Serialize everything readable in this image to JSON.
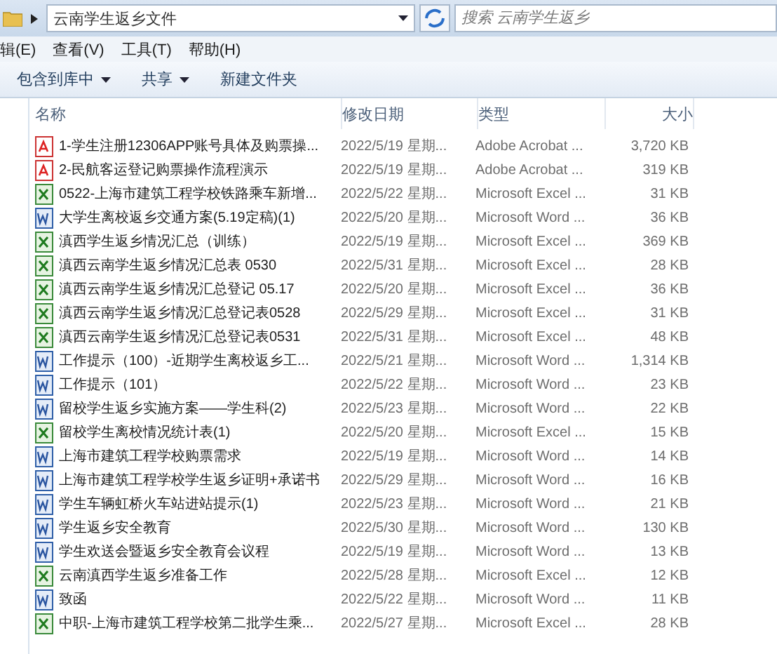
{
  "address_bar": {
    "path": "云南学生返乡文件",
    "search_placeholder": "搜索 云南学生返乡"
  },
  "menu": [
    "辑(E)",
    "查看(V)",
    "工具(T)",
    "帮助(H)"
  ],
  "toolbar": [
    {
      "label": "包含到库中",
      "dropdown": true
    },
    {
      "label": "共享",
      "dropdown": true
    },
    {
      "label": "新建文件夹",
      "dropdown": false
    }
  ],
  "columns": [
    "名称",
    "修改日期",
    "类型",
    "大小"
  ],
  "files": [
    {
      "kind": "pdf",
      "name": "1-学生注册12306APP账号具体及购票操...",
      "date": "2022/5/19 星期...",
      "type": "Adobe Acrobat ...",
      "size": "3,720 KB"
    },
    {
      "kind": "pdf",
      "name": "2-民航客运登记购票操作流程演示",
      "date": "2022/5/19 星期...",
      "type": "Adobe Acrobat ...",
      "size": "319 KB"
    },
    {
      "kind": "excel",
      "name": "0522-上海市建筑工程学校铁路乘车新增...",
      "date": "2022/5/22 星期...",
      "type": "Microsoft Excel ...",
      "size": "31 KB"
    },
    {
      "kind": "word",
      "name": "大学生离校返乡交通方案(5.19定稿)(1)",
      "date": "2022/5/20 星期...",
      "type": "Microsoft Word ...",
      "size": "36 KB"
    },
    {
      "kind": "excel",
      "name": "滇西学生返乡情况汇总（训练）",
      "date": "2022/5/19 星期...",
      "type": "Microsoft Excel ...",
      "size": "369 KB"
    },
    {
      "kind": "excel",
      "name": "滇西云南学生返乡情况汇总表 0530",
      "date": "2022/5/31 星期...",
      "type": "Microsoft Excel ...",
      "size": "28 KB"
    },
    {
      "kind": "excel",
      "name": "滇西云南学生返乡情况汇总登记 05.17",
      "date": "2022/5/20 星期...",
      "type": "Microsoft Excel ...",
      "size": "36 KB"
    },
    {
      "kind": "excel",
      "name": "滇西云南学生返乡情况汇总登记表0528",
      "date": "2022/5/29 星期...",
      "type": "Microsoft Excel ...",
      "size": "31 KB"
    },
    {
      "kind": "excel",
      "name": "滇西云南学生返乡情况汇总登记表0531",
      "date": "2022/5/31 星期...",
      "type": "Microsoft Excel ...",
      "size": "48 KB"
    },
    {
      "kind": "word",
      "name": "工作提示（100）-近期学生离校返乡工...",
      "date": "2022/5/21 星期...",
      "type": "Microsoft Word ...",
      "size": "1,314 KB"
    },
    {
      "kind": "word",
      "name": "工作提示（101）",
      "date": "2022/5/22 星期...",
      "type": "Microsoft Word ...",
      "size": "23 KB"
    },
    {
      "kind": "word",
      "name": "留校学生返乡实施方案——学生科(2)",
      "date": "2022/5/23 星期...",
      "type": "Microsoft Word ...",
      "size": "22 KB"
    },
    {
      "kind": "excel",
      "name": "留校学生离校情况统计表(1)",
      "date": "2022/5/20 星期...",
      "type": "Microsoft Excel ...",
      "size": "15 KB"
    },
    {
      "kind": "word",
      "name": "上海市建筑工程学校购票需求",
      "date": "2022/5/19 星期...",
      "type": "Microsoft Word ...",
      "size": "14 KB"
    },
    {
      "kind": "word",
      "name": "上海市建筑工程学校学生返乡证明+承诺书",
      "date": "2022/5/29 星期...",
      "type": "Microsoft Word ...",
      "size": "16 KB"
    },
    {
      "kind": "word",
      "name": "学生车辆虹桥火车站进站提示(1)",
      "date": "2022/5/23 星期...",
      "type": "Microsoft Word ...",
      "size": "21 KB"
    },
    {
      "kind": "word",
      "name": "学生返乡安全教育",
      "date": "2022/5/30 星期...",
      "type": "Microsoft Word ...",
      "size": "130 KB"
    },
    {
      "kind": "word",
      "name": "学生欢送会暨返乡安全教育会议程",
      "date": "2022/5/19 星期...",
      "type": "Microsoft Word ...",
      "size": "13 KB"
    },
    {
      "kind": "excel",
      "name": "云南滇西学生返乡准备工作",
      "date": "2022/5/28 星期...",
      "type": "Microsoft Excel ...",
      "size": "12 KB"
    },
    {
      "kind": "word",
      "name": "致函",
      "date": "2022/5/22 星期...",
      "type": "Microsoft Word ...",
      "size": "11 KB"
    },
    {
      "kind": "excel",
      "name": "中职-上海市建筑工程学校第二批学生乘...",
      "date": "2022/5/27 星期...",
      "type": "Microsoft Excel ...",
      "size": "28 KB"
    }
  ]
}
